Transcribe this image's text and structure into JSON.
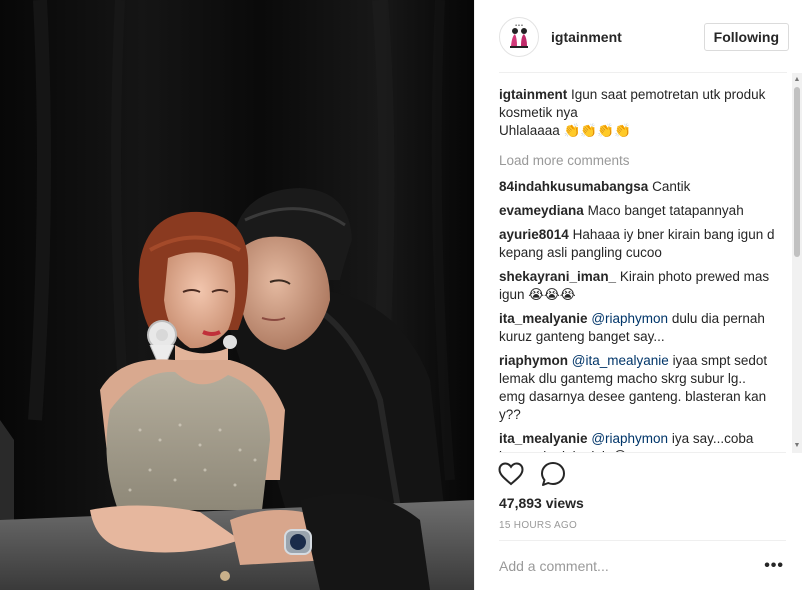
{
  "post": {
    "username": "igtainment",
    "follow_label": "Following",
    "caption": {
      "user": "igtainment",
      "text": "Igun saat pemotretan utk produk kosmetik nya",
      "text2": "Uhlalaaaa 👏👏👏👏"
    },
    "load_more": "Load more comments",
    "comments": [
      {
        "user": "84indahkusumabangsa",
        "text": "Cantik"
      },
      {
        "user": "evameydiana",
        "text": "Maco banget tatapannyah"
      },
      {
        "user": "ayurie8014",
        "text": "Hahaaa iy bner kirain bang igun d kepang asli pangling cucoo"
      },
      {
        "user": "shekayrani_iman_",
        "text": "Kirain photo prewed mas igun 😭😭😭"
      },
      {
        "user": "ita_mealyanie",
        "mention": "@riaphymon",
        "text": "dulu dia pernah kuruz ganteng banget say..."
      },
      {
        "user": "riaphymon",
        "mention": "@ita_mealyanie",
        "text": "iyaa smpt sedot lemak dlu gantemg macho skrg subur lg.. emg dasarnya desee ganteng. blasteran kan y??"
      },
      {
        "user": "ita_mealyanie",
        "mention": "@riaphymon",
        "text": "iya say...coba bayangin dulu deh 😍"
      }
    ],
    "views": "47,893 views",
    "timestamp": "15 HOURS AGO",
    "add_comment_placeholder": "Add a comment...",
    "more_options": "•••"
  },
  "icons": {
    "like": "heart-icon",
    "comment": "comment-bubble-icon",
    "more": "more-options-icon"
  },
  "colors": {
    "mention": "#003569",
    "muted": "#999999",
    "divider": "#efefef"
  }
}
